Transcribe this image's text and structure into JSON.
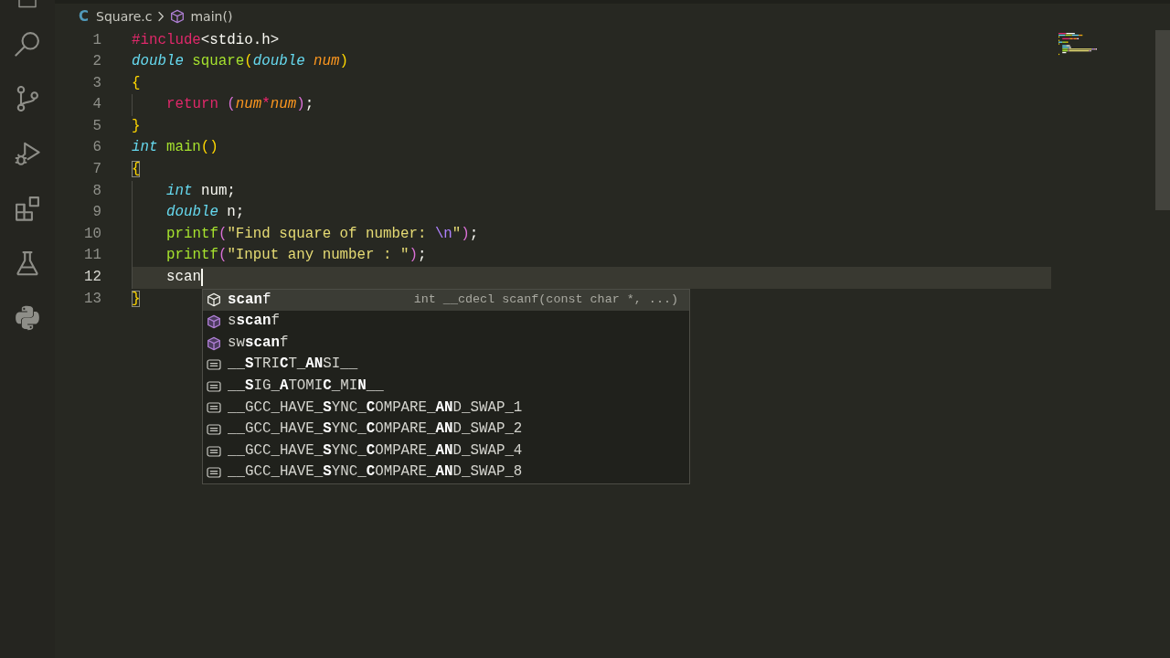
{
  "activity_bar": {
    "items": [
      {
        "kind": "explorer"
      },
      {
        "kind": "search"
      },
      {
        "kind": "scm"
      },
      {
        "kind": "debug"
      },
      {
        "kind": "extensions"
      },
      {
        "kind": "testing"
      },
      {
        "kind": "python"
      }
    ]
  },
  "breadcrumbs": [
    {
      "kind": "file",
      "badge": "C",
      "label": "Square.c"
    },
    {
      "kind": "function",
      "label": "main()"
    }
  ],
  "editor": {
    "lines": [
      {
        "number": "1",
        "indented": false,
        "current": false,
        "cursor": false,
        "tokens": [
          {
            "kind": "directive",
            "text": "#include"
          },
          {
            "kind": "header",
            "text": "<stdio.h>"
          }
        ]
      },
      {
        "number": "2",
        "indented": false,
        "current": false,
        "cursor": false,
        "tokens": [
          {
            "kind": "type",
            "text": "double "
          },
          {
            "kind": "function",
            "text": "square"
          },
          {
            "kind": "outerbracket",
            "text": "(",
            "matched": false
          },
          {
            "kind": "type",
            "text": "double "
          },
          {
            "kind": "param",
            "text": "num"
          },
          {
            "kind": "outerbracket",
            "text": ")",
            "matched": false
          }
        ]
      },
      {
        "number": "3",
        "indented": false,
        "current": false,
        "cursor": false,
        "tokens": [
          {
            "kind": "outerbracket",
            "text": "{",
            "matched": false
          }
        ]
      },
      {
        "number": "4",
        "indented": true,
        "current": false,
        "cursor": false,
        "tokens": [
          {
            "kind": "keyword",
            "text": "return "
          },
          {
            "kind": "innerbracket",
            "text": "(",
            "matched": false
          },
          {
            "kind": "param",
            "text": "num"
          },
          {
            "kind": "operator",
            "text": "*"
          },
          {
            "kind": "param",
            "text": "num"
          },
          {
            "kind": "innerbracket",
            "text": ")",
            "matched": false
          },
          {
            "kind": "punct",
            "text": ";"
          }
        ]
      },
      {
        "number": "5",
        "indented": false,
        "current": false,
        "cursor": false,
        "tokens": [
          {
            "kind": "outerbracket",
            "text": "}",
            "matched": false
          }
        ]
      },
      {
        "number": "6",
        "indented": false,
        "current": false,
        "cursor": false,
        "tokens": [
          {
            "kind": "type",
            "text": "int "
          },
          {
            "kind": "function",
            "text": "main"
          },
          {
            "kind": "outerbracket",
            "text": "()",
            "matched": false
          }
        ]
      },
      {
        "number": "7",
        "indented": false,
        "current": false,
        "cursor": false,
        "tokens": [
          {
            "kind": "outerbracket",
            "text": "{",
            "matched": true
          }
        ]
      },
      {
        "number": "8",
        "indented": true,
        "current": false,
        "cursor": false,
        "tokens": [
          {
            "kind": "type",
            "text": "int "
          },
          {
            "kind": "plain",
            "text": "num;"
          }
        ]
      },
      {
        "number": "9",
        "indented": true,
        "current": false,
        "cursor": false,
        "tokens": [
          {
            "kind": "type",
            "text": "double "
          },
          {
            "kind": "plain",
            "text": "n;"
          }
        ]
      },
      {
        "number": "10",
        "indented": true,
        "current": false,
        "cursor": false,
        "tokens": [
          {
            "kind": "function",
            "text": "printf"
          },
          {
            "kind": "innerbracket",
            "text": "(",
            "matched": false
          },
          {
            "kind": "string",
            "text": "\"Find square of number: "
          },
          {
            "kind": "escape",
            "text": "\\n"
          },
          {
            "kind": "string",
            "text": "\""
          },
          {
            "kind": "innerbracket",
            "text": ")",
            "matched": false
          },
          {
            "kind": "punct",
            "text": ";"
          }
        ]
      },
      {
        "number": "11",
        "indented": true,
        "current": false,
        "cursor": false,
        "tokens": [
          {
            "kind": "function",
            "text": "printf"
          },
          {
            "kind": "innerbracket",
            "text": "(",
            "matched": false
          },
          {
            "kind": "string",
            "text": "\"Input any number : \""
          },
          {
            "kind": "innerbracket",
            "text": ")",
            "matched": false
          },
          {
            "kind": "punct",
            "text": ";"
          }
        ]
      },
      {
        "number": "12",
        "indented": true,
        "current": true,
        "cursor": true,
        "tokens": [
          {
            "kind": "plain",
            "text": "scan"
          }
        ]
      },
      {
        "number": "13",
        "indented": false,
        "current": false,
        "cursor": false,
        "tokens": [
          {
            "kind": "outerbracket",
            "text": "}",
            "matched": true
          }
        ]
      }
    ]
  },
  "suggestions": {
    "items": [
      {
        "kind": "function",
        "label": "**scan**f",
        "detail": "int __cdecl scanf(const char *, ...)",
        "selected": true
      },
      {
        "kind": "function",
        "label": "s**scan**f",
        "selected": false
      },
      {
        "kind": "function",
        "label": "sw**scan**f",
        "selected": false
      },
      {
        "kind": "constant",
        "label": "__**S**TRI**C**T_**AN**SI__",
        "selected": false
      },
      {
        "kind": "constant",
        "label": "__**S**IG_**A**TOMI**C**_MI**N**__",
        "selected": false
      },
      {
        "kind": "constant",
        "label": "__GCC_HAVE_**S**YNC_**C**OMPARE_**AN**D_SWAP_1",
        "selected": false
      },
      {
        "kind": "constant",
        "label": "__GCC_HAVE_**S**YNC_**C**OMPARE_**AN**D_SWAP_2",
        "selected": false
      },
      {
        "kind": "constant",
        "label": "__GCC_HAVE_**S**YNC_**C**OMPARE_**AN**D_SWAP_4",
        "selected": false
      },
      {
        "kind": "constant",
        "label": "__GCC_HAVE_**S**YNC_**C**OMPARE_**AN**D_SWAP_8",
        "selected": false
      }
    ]
  }
}
